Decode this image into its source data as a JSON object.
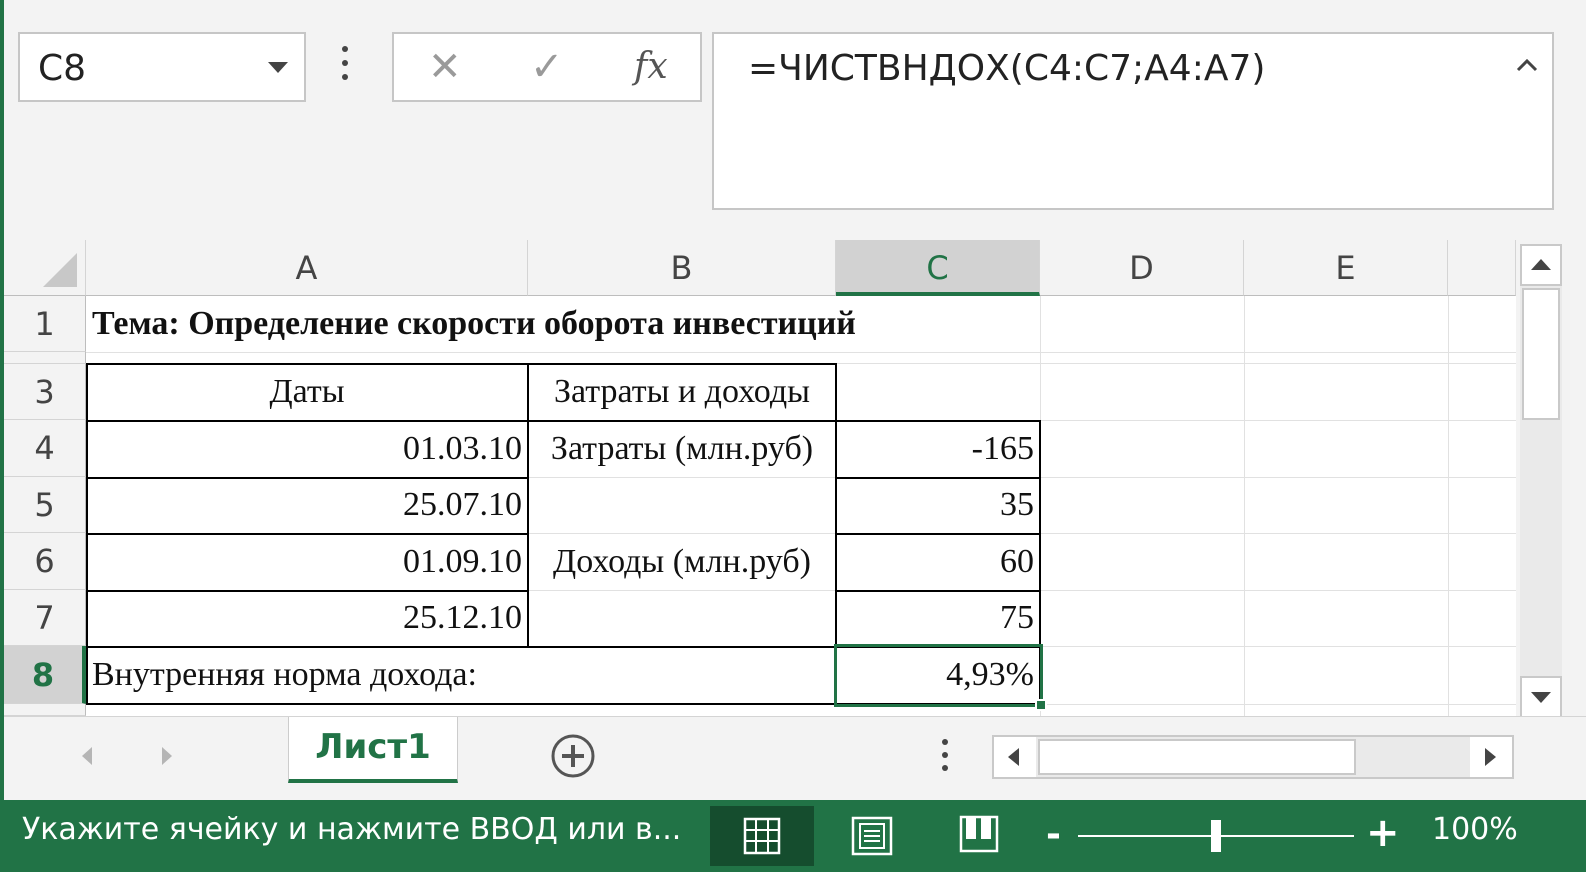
{
  "formula_bar": {
    "name_box": "C8",
    "cancel_glyph": "✕",
    "enter_glyph": "✓",
    "fx_label": "fx",
    "formula": "=ЧИСТВНДОХ(C4:C7;A4:A7)"
  },
  "columns": [
    "A",
    "B",
    "C",
    "D",
    "E"
  ],
  "rows": [
    "1",
    "3",
    "4",
    "5",
    "6",
    "7",
    "8"
  ],
  "cells": {
    "A1": "Тема: Определение скорости оборота инвестиций",
    "A3": "Даты",
    "B3": "Затраты и доходы",
    "A4": "01.03.10",
    "B4": "Затраты (млн.руб)",
    "C4": "-165",
    "A5": "25.07.10",
    "C5": "35",
    "A6": "01.09.10",
    "B5_7": "Доходы (млн.руб)",
    "C6": "60",
    "A7": "25.12.10",
    "C7": "75",
    "A8": "Внутренняя норма дохода:",
    "C8": "4,93%"
  },
  "selection": {
    "active_cell": "C8",
    "active_column": "C",
    "active_row": "8"
  },
  "sheet_tabs": {
    "active": "Лист1"
  },
  "status_bar": {
    "message": "Укажите ячейку и нажмите ВВОД или в...",
    "zoom": "100%",
    "zoom_fraction": 0.5,
    "zoom_minus": "-",
    "zoom_plus": "+"
  },
  "colors": {
    "accent": "#217346",
    "header_bg": "#f3f3f3",
    "active_header_bg": "#d2d2d2"
  },
  "icons": [
    "dropdown-arrow-icon",
    "more-options-icon",
    "cancel-icon",
    "enter-icon",
    "insert-function-icon",
    "collapse-formula-bar-icon",
    "scroll-up-icon",
    "scroll-down-icon",
    "prev-sheet-icon",
    "next-sheet-icon",
    "add-sheet-icon",
    "scroll-left-icon",
    "scroll-right-icon",
    "normal-view-icon",
    "page-layout-view-icon",
    "page-break-preview-icon"
  ]
}
